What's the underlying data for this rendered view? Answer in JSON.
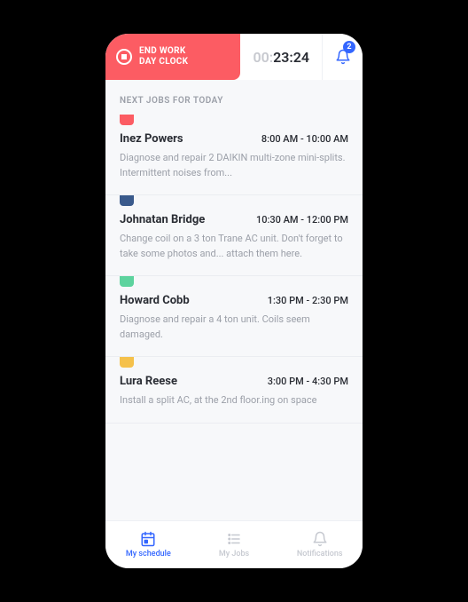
{
  "header": {
    "end_clock_label": "END WORK\nDAY CLOCK",
    "timer_prefix": "00:",
    "timer_main": "23:24",
    "notif_count": "2"
  },
  "section_title": "NEXT JOBS FOR TODAY",
  "jobs": [
    {
      "color": "#fc5c63",
      "name": "Inez Powers",
      "time": "8:00 AM - 10:00 AM",
      "desc": "Diagnose and repair 2 DAIKIN multi-zone mini-splits. Intermittent noises from..."
    },
    {
      "color": "#3a5a8c",
      "name": "Johnatan Bridge",
      "time": "10:30 AM - 12:00 PM",
      "desc": "Change coil on a 3 ton Trane AC unit. Don't forget to take some photos and... attach them here."
    },
    {
      "color": "#5dd39e",
      "name": "Howard Cobb",
      "time": "1:30 PM - 2:30 PM",
      "desc": "Diagnose and repair a 4 ton unit. Coils seem damaged."
    },
    {
      "color": "#f5c14b",
      "name": "Lura Reese",
      "time": "3:00 PM - 4:30 PM",
      "desc": "Install a split AC, at the 2nd floor.ing on space"
    }
  ],
  "tabs": {
    "schedule": "My schedule",
    "jobs": "My Jobs",
    "notifications": "Notifications"
  }
}
